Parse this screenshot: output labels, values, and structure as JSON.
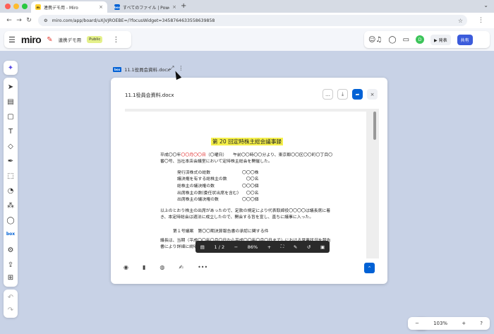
{
  "browser": {
    "tabs": [
      {
        "title": "連携デモ用 - Miro",
        "active": true
      },
      {
        "title": "すべてのファイル | Powered by",
        "active": false
      }
    ],
    "url": "miro.com/app/board/uXjVJROEBE=/?focusWidget=3458764633558639858"
  },
  "miro": {
    "logo": "miro",
    "board_name": "連携デモ用",
    "visibility": "Public",
    "present_label": "▶ 発表",
    "share_label": "共有",
    "avatar_initial": "D"
  },
  "widget": {
    "label": "11.1役員会資料.docx",
    "preview_title": "11.1役員会資料.docx"
  },
  "document": {
    "title": "第 20 回定時株主総会議事録",
    "intro_prefix": "平成〇〇年",
    "intro_red": "〇〇月〇〇日",
    "intro_rest": "（〇曜日）　　午前〇〇時〇〇分より、東京都〇〇区〇〇町〇丁目〇番〇号、当社本店会議室において定時株主総会を開催した。",
    "list": [
      {
        "k": "発行済株式の総数",
        "v": "〇〇〇株"
      },
      {
        "k": "議決権を有する総株主の数",
        "v": "　〇〇名"
      },
      {
        "k": "総株主の議決権の数",
        "v": "〇〇〇個"
      },
      {
        "k": "出席株主の数(委任状出席を含む)",
        "v": "　〇〇名"
      },
      {
        "k": "出席株主の議決権の数",
        "v": "〇〇〇個"
      }
    ],
    "p2": "以上のとおり株主の出席があったので、定款の規定により代表取締役〇〇〇〇は議長席に着き、本定時総会は適法に成立したので、開会する旨を宣し、直ちに議事に入った。",
    "agenda1": "第１号議案　第〇〇期決算報告書の承認に関する件",
    "p3": "議長は、当期（平成〇〇年〇月〇日から平成〇〇年〇月〇日まで）における営業状況を報告書により詳細に説明報告し、下記の書類を提出して、その承認を求めた。"
  },
  "pdf_toolbar": {
    "page": "1 / 2",
    "zoom": "86%"
  },
  "zoom_panel": {
    "level": "103%"
  }
}
